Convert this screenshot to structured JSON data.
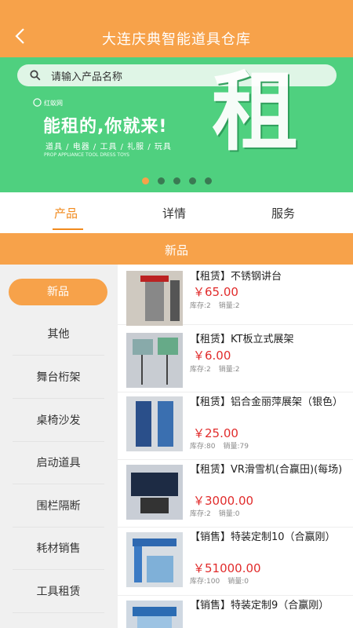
{
  "header": {
    "title": "大连庆典智能道具仓库",
    "back_icon": "chevron-left-icon"
  },
  "search": {
    "placeholder": "请输入产品名称",
    "icon": "search-icon"
  },
  "banner": {
    "brand": "红蚁网",
    "slogan": "能租的,你就来!",
    "categories": "道具 / 电器 / 工具 / 礼服 / 玩具",
    "categories_en": "PROP APPLIANCE TOOL DRESS TOYS",
    "big_char": "租",
    "carousel_active": 0,
    "carousel_count": 5
  },
  "tabs": [
    {
      "label": "产品",
      "active": true
    },
    {
      "label": "详情",
      "active": false
    },
    {
      "label": "服务",
      "active": false
    }
  ],
  "section_title": "新品",
  "sidebar": [
    "新品",
    "其他",
    "舞台桁架",
    "桌椅沙发",
    "启动道具",
    "围栏隔断",
    "耗材销售",
    "工具租赁"
  ],
  "products": [
    {
      "name": "【租赁】不锈钢讲台",
      "price": "￥65.00",
      "stock": "库存:2",
      "sales": "销量:2"
    },
    {
      "name": "【租赁】KT板立式展架",
      "price": "￥6.00",
      "stock": "库存:2",
      "sales": "销量:2"
    },
    {
      "name": "【租赁】铝合金丽萍展架（银色）",
      "price": "￥25.00",
      "stock": "库存:80",
      "sales": "销量:79"
    },
    {
      "name": "【租赁】VR滑雪机(合赢田)(每场)",
      "price": "￥3000.00",
      "stock": "库存:2",
      "sales": "销量:0"
    },
    {
      "name": "【销售】特装定制10（合赢刚）",
      "price": "￥51000.00",
      "stock": "库存:100",
      "sales": "销量:0"
    },
    {
      "name": "【销售】特装定制9（合赢刚）",
      "price": "",
      "stock": "",
      "sales": ""
    }
  ],
  "colors": {
    "accent": "#f7a24a",
    "banner_green": "#4fd07f",
    "price_red": "#e12c2c"
  }
}
